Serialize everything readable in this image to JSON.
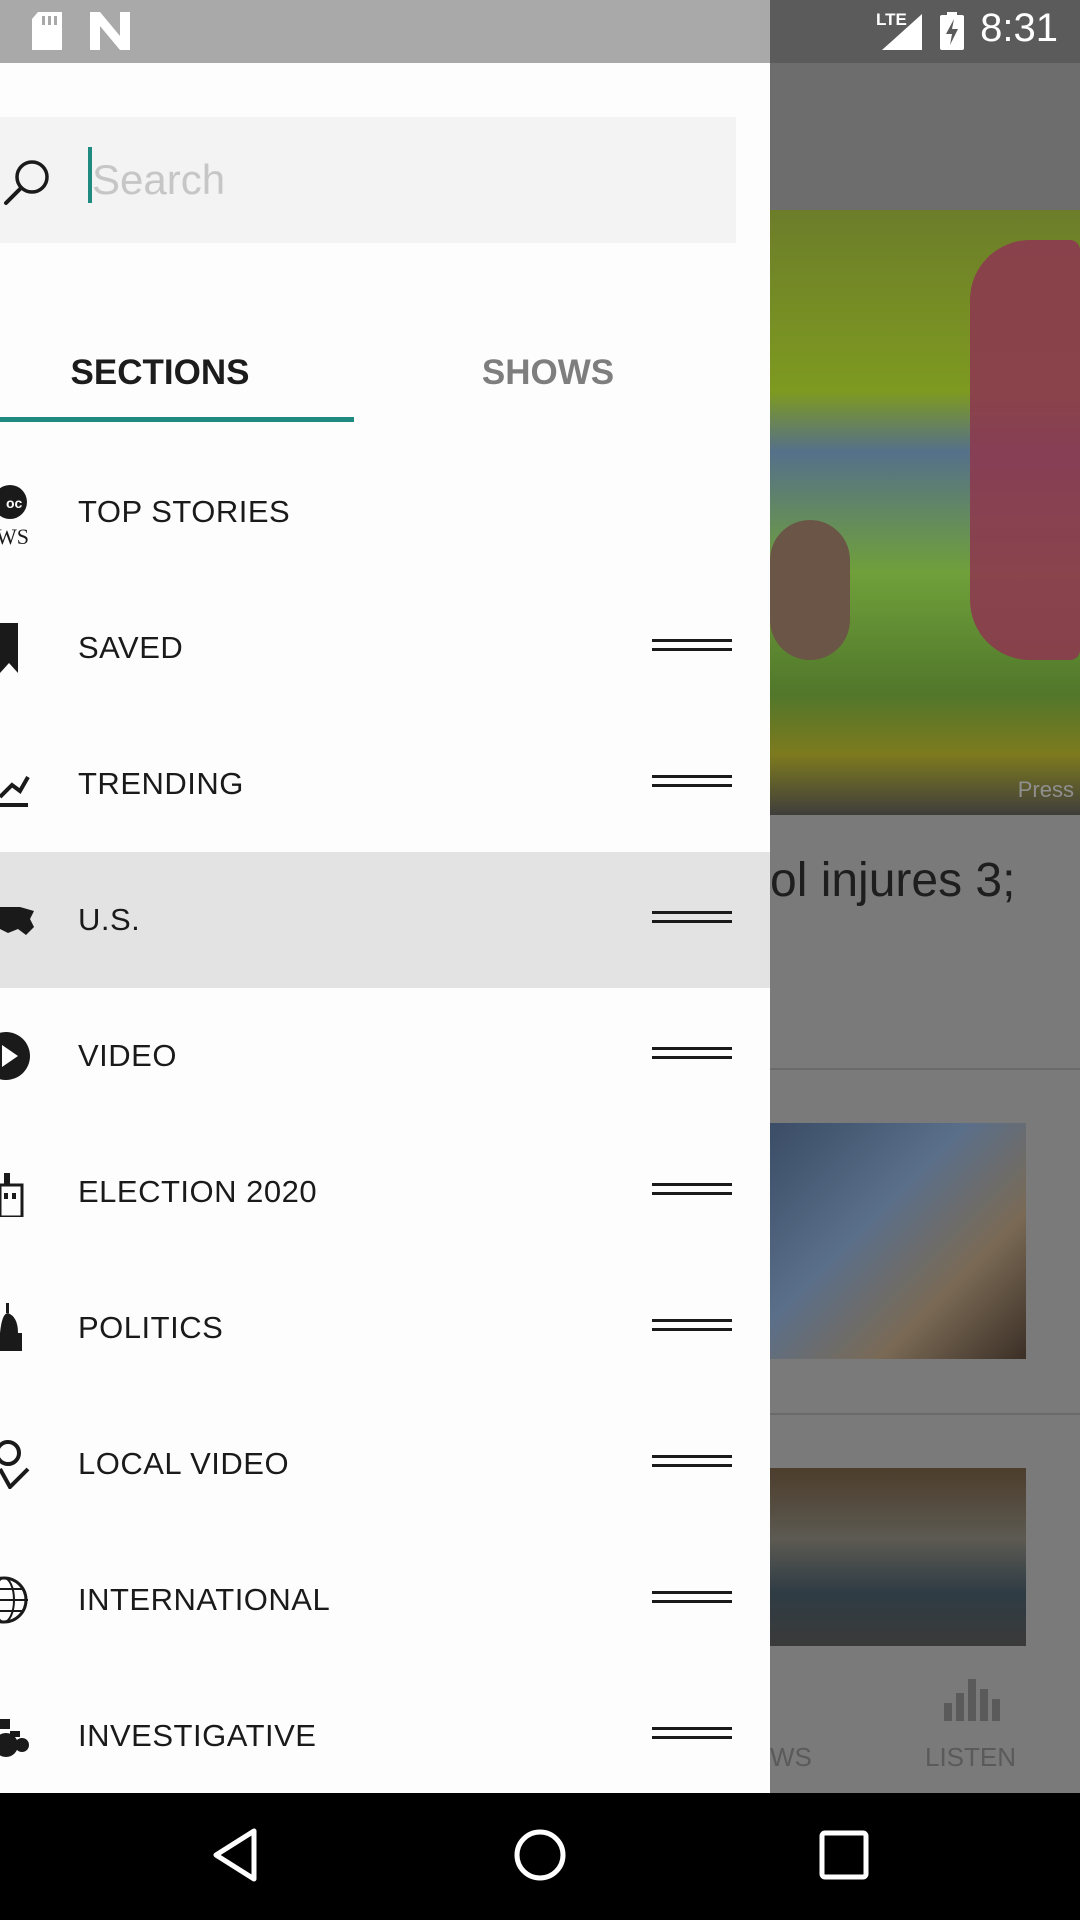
{
  "status_bar": {
    "time": "8:31",
    "network": "LTE",
    "icons": [
      "sd-card-icon",
      "n-app-icon",
      "lte-signal-icon",
      "battery-charging-icon"
    ]
  },
  "drawer": {
    "search": {
      "placeholder": "Search",
      "value": ""
    },
    "tabs": [
      {
        "label": "SECTIONS",
        "selected": true
      },
      {
        "label": "SHOWS",
        "selected": false
      }
    ],
    "sections": [
      {
        "label": "TOP STORIES",
        "icon": "abc-news-logo-icon",
        "reorderable": false
      },
      {
        "label": "SAVED",
        "icon": "bookmark-icon",
        "reorderable": true
      },
      {
        "label": "TRENDING",
        "icon": "trending-icon",
        "reorderable": true
      },
      {
        "label": "U.S.",
        "icon": "us-map-icon",
        "reorderable": true,
        "selected": true
      },
      {
        "label": "VIDEO",
        "icon": "play-icon",
        "reorderable": true
      },
      {
        "label": "ELECTION 2020",
        "icon": "capitol-building-icon",
        "reorderable": true
      },
      {
        "label": "POLITICS",
        "icon": "dome-icon",
        "reorderable": true
      },
      {
        "label": "LOCAL VIDEO",
        "icon": "location-pin-icon",
        "reorderable": true
      },
      {
        "label": "INTERNATIONAL",
        "icon": "globe-icon",
        "reorderable": true
      },
      {
        "label": "INVESTIGATIVE",
        "icon": "binoculars-icon",
        "reorderable": true
      }
    ]
  },
  "background": {
    "headline_fragment": "ol injures 3;",
    "hero_caption": "Press",
    "bottom_tabs": [
      {
        "label": "WS"
      },
      {
        "label": "LISTEN"
      }
    ]
  },
  "colors": {
    "accent": "#1f8a80",
    "selected_row": "#e3e3e3",
    "drawer_bg": "#fdfdfd"
  }
}
